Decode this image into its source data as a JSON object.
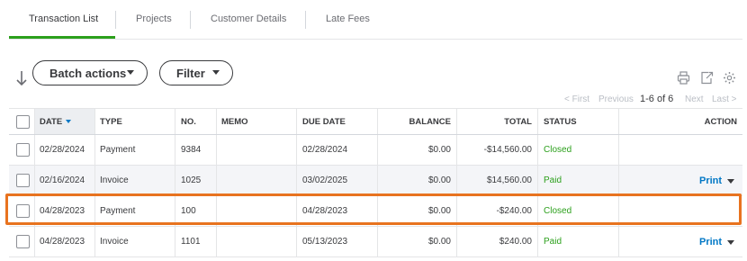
{
  "tabs": [
    {
      "label": "Transaction List",
      "active": true
    },
    {
      "label": "Projects",
      "active": false
    },
    {
      "label": "Customer Details",
      "active": false
    },
    {
      "label": "Late Fees",
      "active": false
    }
  ],
  "toolbar": {
    "batch_actions_label": "Batch actions",
    "filter_label": "Filter",
    "icons": [
      "print-icon",
      "export-icon",
      "settings-icon"
    ]
  },
  "pager": {
    "first": "< First",
    "previous": "Previous",
    "range": "1-6 of 6",
    "next": "Next",
    "last": "Last >"
  },
  "table": {
    "columns": [
      "DATE",
      "TYPE",
      "NO.",
      "MEMO",
      "DUE DATE",
      "BALANCE",
      "TOTAL",
      "STATUS",
      "ACTION"
    ],
    "rows": [
      {
        "date": "02/28/2024",
        "type": "Payment",
        "no": "9384",
        "memo": "",
        "due_date": "02/28/2024",
        "balance": "$0.00",
        "total": "-$14,560.00",
        "status": "Closed",
        "action": ""
      },
      {
        "date": "02/16/2024",
        "type": "Invoice",
        "no": "1025",
        "memo": "",
        "due_date": "03/02/2025",
        "balance": "$0.00",
        "total": "$14,560.00",
        "status": "Paid",
        "action": "Print"
      },
      {
        "date": "04/28/2023",
        "type": "Payment",
        "no": "100",
        "memo": "",
        "due_date": "04/28/2023",
        "balance": "$0.00",
        "total": "-$240.00",
        "status": "Closed",
        "action": ""
      },
      {
        "date": "04/28/2023",
        "type": "Invoice",
        "no": "1101",
        "memo": "",
        "due_date": "05/13/2023",
        "balance": "$0.00",
        "total": "$240.00",
        "status": "Paid",
        "action": "Print"
      }
    ]
  },
  "colors": {
    "accent_green": "#2ca01c",
    "link_blue": "#0077c5",
    "highlight_orange": "#e8731f"
  }
}
